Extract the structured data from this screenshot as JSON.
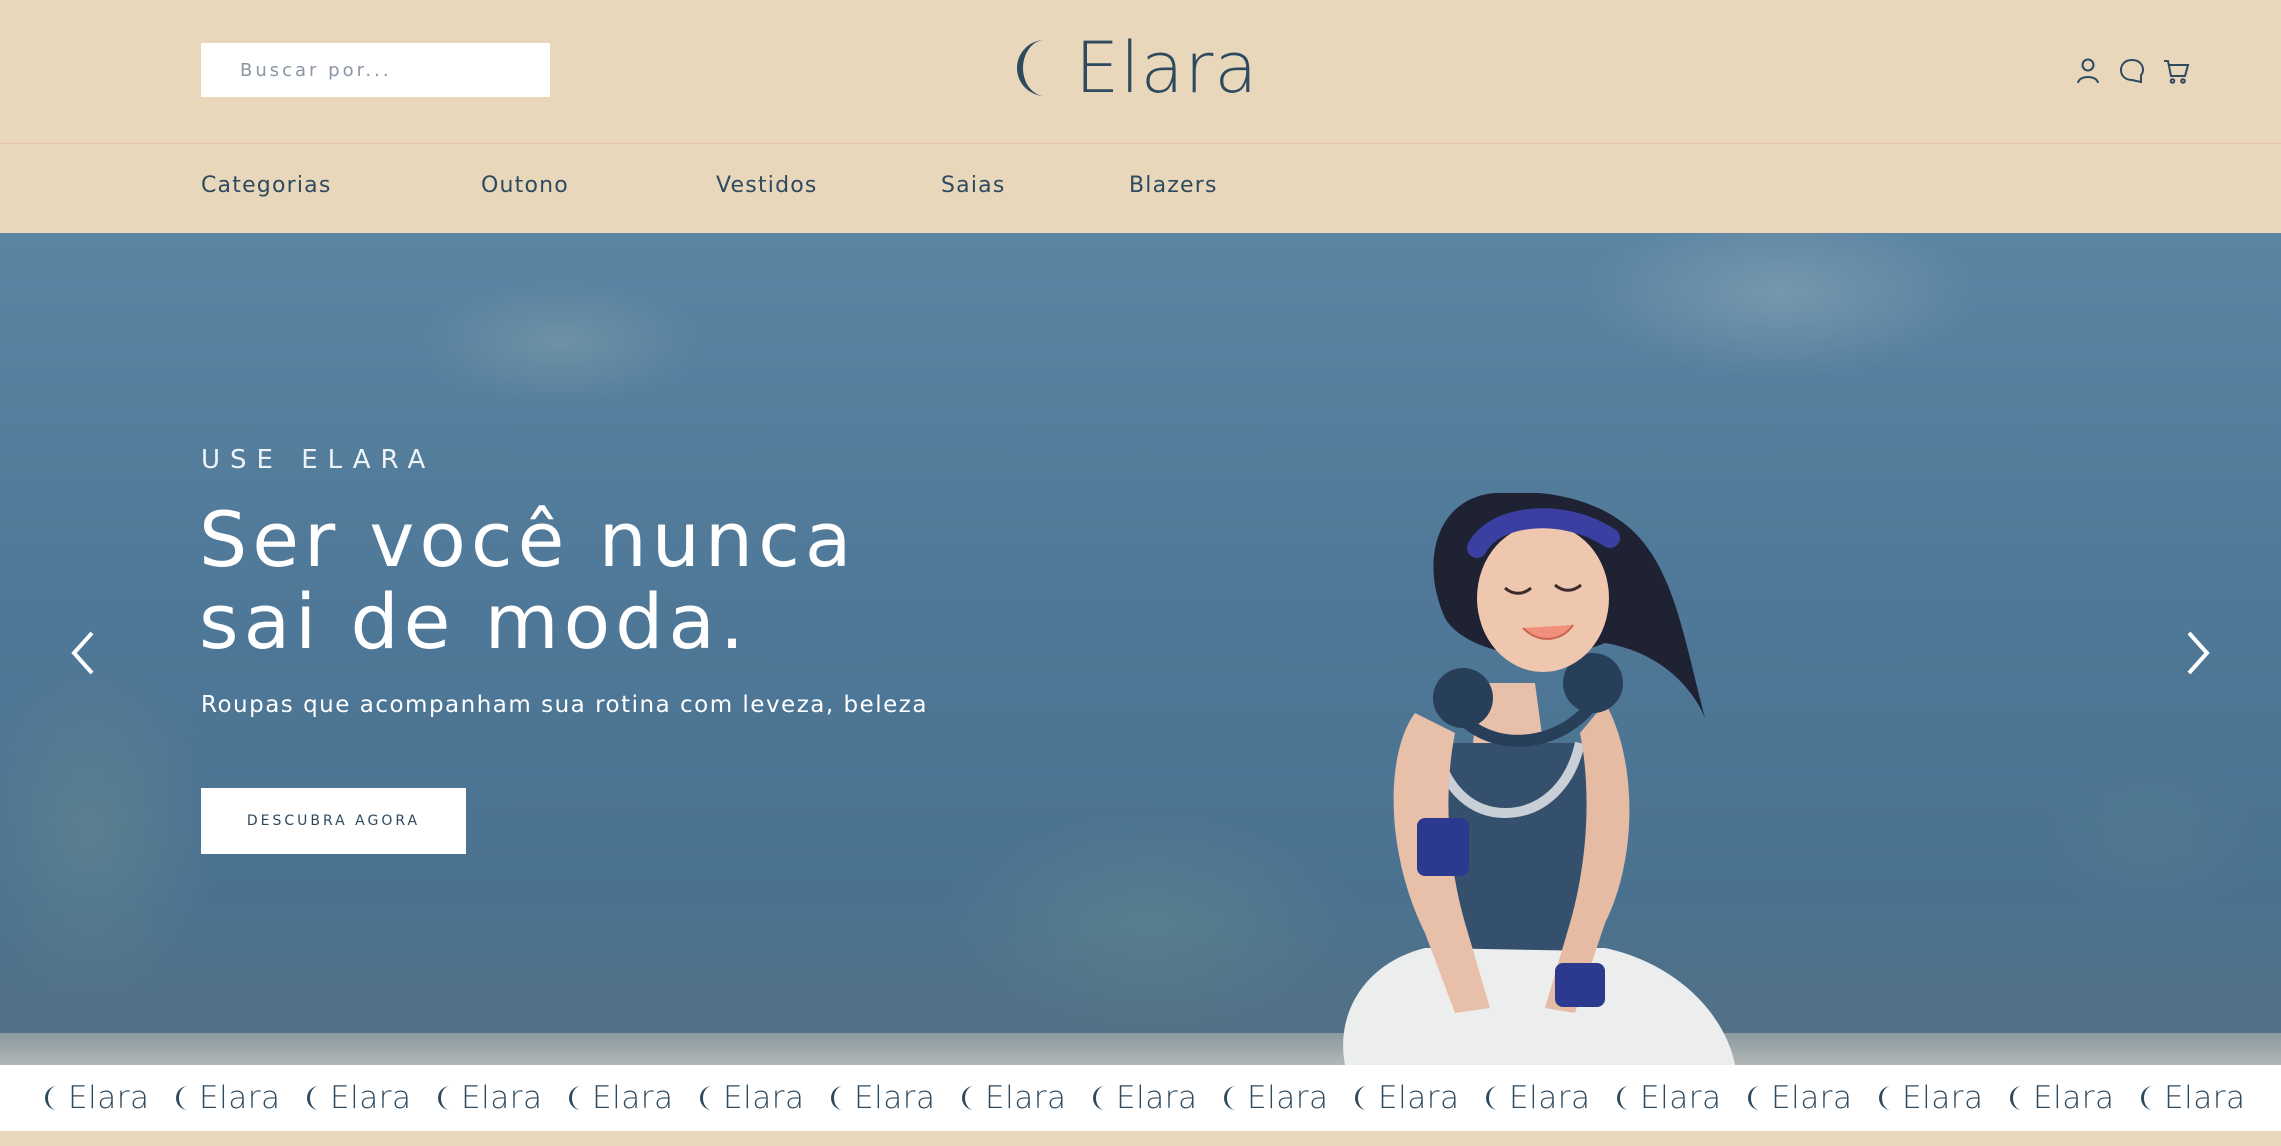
{
  "header": {
    "search_placeholder": "Buscar por...",
    "brand": "Elara",
    "icons": [
      "user-icon",
      "chat-icon",
      "cart-icon"
    ]
  },
  "nav": {
    "items": [
      "Categorias",
      "Outono",
      "Vestidos",
      "Saias",
      "Blazers"
    ]
  },
  "hero": {
    "eyebrow": "USE ELARA",
    "headline_line1": "Ser você nunca",
    "headline_line2": "sai de moda.",
    "subtitle": "Roupas que acompanham sua rotina com leveza, beleza",
    "cta_label": "DESCUBRA AGORA"
  },
  "marquee": {
    "items": [
      "Elara",
      "Elara",
      "Elara",
      "Elara",
      "Elara",
      "Elara",
      "Elara",
      "Elara",
      "Elara",
      "Elara",
      "Elara",
      "Elara",
      "Elara",
      "Elara",
      "Elara",
      "Elara",
      "Elara"
    ]
  },
  "colors": {
    "beige": "#e9d7bc",
    "navy": "#2e4a5f",
    "hero_blue": "#4f7898",
    "white": "#ffffff"
  }
}
